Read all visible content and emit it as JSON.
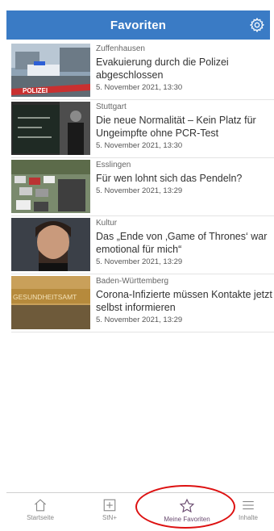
{
  "header": {
    "title": "Favoriten",
    "settings_icon": "gear-icon",
    "bg": "#3a7bc5"
  },
  "articles": [
    {
      "category": "Zuffenhausen",
      "headline": "Evakuierung durch die Polizei abgeschlossen",
      "date": "5. November 2021, 13:30",
      "image_text": "POLIZEI"
    },
    {
      "category": "Stuttgart",
      "headline": "Die neue Normalität – Kein Platz für Ungeimpfte ohne PCR-Test",
      "date": "5. November 2021, 13:30"
    },
    {
      "category": "Esslingen",
      "headline": "Für wen lohnt sich das Pendeln?",
      "date": "5. November 2021, 13:29"
    },
    {
      "category": "Kultur",
      "headline": "Das „Ende von ‚Game of Thrones‘ war emotional für mich“",
      "date": "5. November 2021, 13:29"
    },
    {
      "category": "Baden-Württemberg",
      "headline": "Corona-Infizierte müssen Kontakte jetzt selbst informieren",
      "date": "5. November 2021, 13:29",
      "image_text": "GESUNDHEITSAMT"
    }
  ],
  "tabbar": {
    "tabs": [
      {
        "label": "Startseite",
        "icon": "home-icon"
      },
      {
        "label": "StN+",
        "icon": "plus-square-icon"
      },
      {
        "label": "Meine Favoriten",
        "icon": "star-icon",
        "active": true
      },
      {
        "label": "Inhalte",
        "icon": "menu-icon"
      }
    ]
  },
  "highlight_color": "#d11"
}
